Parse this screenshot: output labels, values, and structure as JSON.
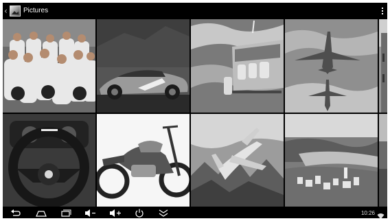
{
  "app": {
    "title": "Pictures",
    "icon": "gallery-icon"
  },
  "actionbar": {
    "back_icon": "back-caret-icon",
    "overflow_icon": "overflow-menu-icon"
  },
  "grid": {
    "tiles": [
      {
        "subject": "astronauts",
        "icon": "photo-thumbnail"
      },
      {
        "subject": "sports-car",
        "icon": "photo-thumbnail"
      },
      {
        "subject": "skydivers-plane",
        "icon": "photo-thumbnail"
      },
      {
        "subject": "fighter-jets",
        "icon": "photo-thumbnail"
      },
      {
        "subject": "church",
        "icon": "photo-thumbnail"
      },
      {
        "subject": "steering-wheel",
        "icon": "photo-thumbnail"
      },
      {
        "subject": "motorcycle",
        "icon": "photo-thumbnail"
      },
      {
        "subject": "airliner-over-mountains",
        "icon": "photo-thumbnail"
      },
      {
        "subject": "river-town",
        "icon": "photo-thumbnail"
      },
      {
        "subject": "landscape",
        "icon": "photo-thumbnail"
      }
    ]
  },
  "navbar": {
    "buttons": [
      "back-icon",
      "home-icon",
      "recent-apps-icon",
      "volume-down-icon",
      "volume-up-icon",
      "power-icon",
      "collapse-icon"
    ],
    "clock": "10:26",
    "wifi_icon": "wifi-icon"
  },
  "colors": {
    "bar_background": "#000000",
    "frame_background": "#ffffff"
  }
}
